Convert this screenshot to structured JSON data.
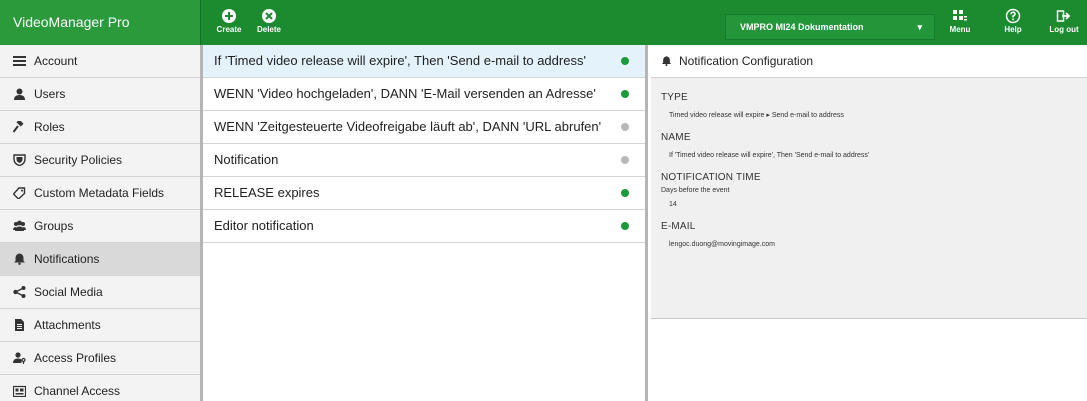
{
  "app": {
    "title": "VideoManager Pro"
  },
  "toolbar": {
    "create_label": "Create",
    "delete_label": "Delete",
    "menu_label": "Menu",
    "help_label": "Help",
    "logout_label": "Log out",
    "doc_select_value": "VMPRO MI24 Dokumentation",
    "accent_color": "#1c8a2e"
  },
  "sidebar": {
    "items": [
      {
        "label": "Account",
        "icon": "list-icon"
      },
      {
        "label": "Users",
        "icon": "user-icon"
      },
      {
        "label": "Roles",
        "icon": "gavel-icon"
      },
      {
        "label": "Security Policies",
        "icon": "shield-icon"
      },
      {
        "label": "Custom Metadata Fields",
        "icon": "tag-icon"
      },
      {
        "label": "Groups",
        "icon": "users-icon"
      },
      {
        "label": "Notifications",
        "icon": "bell-icon"
      },
      {
        "label": "Social Media",
        "icon": "share-icon"
      },
      {
        "label": "Attachments",
        "icon": "file-icon"
      },
      {
        "label": "Access Profiles",
        "icon": "user-key-icon"
      },
      {
        "label": "Channel Access",
        "icon": "channel-icon"
      }
    ],
    "active_index": 6
  },
  "notifications": {
    "items": [
      {
        "label": "If 'Timed video release will expire', Then 'Send e-mail to address'",
        "status": "active"
      },
      {
        "label": "WENN 'Video hochgeladen', DANN 'E-Mail versenden an Adresse'",
        "status": "active"
      },
      {
        "label": "WENN 'Zeitgesteuerte Videofreigabe läuft ab', DANN 'URL abrufen'",
        "status": "inactive"
      },
      {
        "label": "Notification",
        "status": "inactive"
      },
      {
        "label": "RELEASE expires",
        "status": "active"
      },
      {
        "label": "Editor notification",
        "status": "active"
      }
    ],
    "selected_index": 0,
    "status_colors": {
      "active": "#1a9a3a",
      "inactive": "#b8b8b8"
    }
  },
  "detail": {
    "title": "Notification Configuration",
    "type_label": "TYPE",
    "type_value": "Timed video release will expire ▸ Send e-mail to address",
    "name_label": "NAME",
    "name_value": "If 'Timed video release will expire', Then 'Send e-mail to address'",
    "time_label": "NOTIFICATION TIME",
    "time_sub": "Days before the event",
    "time_value": "14",
    "email_label": "E-MAIL",
    "email_value": "lengoc.duong@movingimage.com"
  }
}
